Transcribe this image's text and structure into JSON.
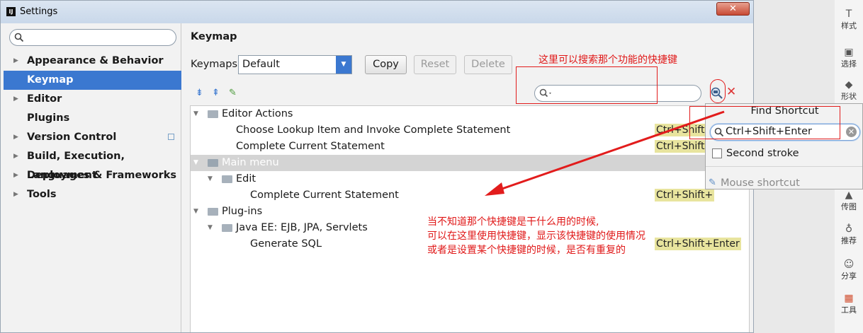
{
  "window": {
    "title": "Settings",
    "app_icon_text": "IJ",
    "close": "✕"
  },
  "sidebar": {
    "search_placeholder": "",
    "items": [
      {
        "label": "Appearance & Behavior",
        "arrow": "▶"
      },
      {
        "label": "Keymap",
        "arrow": ""
      },
      {
        "label": "Editor",
        "arrow": "▶"
      },
      {
        "label": "Plugins",
        "arrow": ""
      },
      {
        "label": "Version Control",
        "arrow": "▶"
      },
      {
        "label": "Build, Execution, Deployment",
        "arrow": "▶"
      },
      {
        "label": "Languages & Frameworks",
        "arrow": "▶"
      },
      {
        "label": "Tools",
        "arrow": "▶"
      }
    ]
  },
  "main": {
    "title": "Keymap",
    "keymaps_label": "Keymaps:",
    "keymap_value": "Default",
    "buttons": {
      "copy": "Copy",
      "reset": "Reset",
      "delete": "Delete"
    }
  },
  "tree": {
    "rows": [
      {
        "text": "Editor Actions",
        "toggle": "▼",
        "shortcut": ""
      },
      {
        "text": "Choose Lookup Item and Invoke Complete Statement",
        "toggle": "",
        "shortcut": "Ctrl+Shift+"
      },
      {
        "text": "Complete Current Statement",
        "toggle": "",
        "shortcut": "Ctrl+Shift+"
      },
      {
        "text": "Main menu",
        "toggle": "▼",
        "shortcut": ""
      },
      {
        "text": "Edit",
        "toggle": "▼",
        "shortcut": ""
      },
      {
        "text": "Complete Current Statement",
        "toggle": "",
        "shortcut": "Ctrl+Shift+"
      },
      {
        "text": "Plug-ins",
        "toggle": "▼",
        "shortcut": ""
      },
      {
        "text": "Java EE: EJB, JPA, Servlets",
        "toggle": "▼",
        "shortcut": ""
      },
      {
        "text": "Generate SQL",
        "toggle": "",
        "shortcut": "Ctrl+Shift+Enter"
      }
    ]
  },
  "find_popup": {
    "title": "Find Shortcut",
    "input_value": "Ctrl+Shift+Enter",
    "second_stroke": "Second stroke",
    "mouse_shortcut": "Mouse shortcut",
    "clear": "✕"
  },
  "toolbar_strip": [
    {
      "label": "样式",
      "icon": "style-icon"
    },
    {
      "label": "选择",
      "icon": "select-icon"
    },
    {
      "label": "形状",
      "icon": "shape-icon"
    },
    {
      "label": "传图",
      "icon": "upload-image-icon"
    },
    {
      "label": "推荐",
      "icon": "recommend-icon"
    },
    {
      "label": "分享",
      "icon": "share-icon"
    },
    {
      "label": "工具",
      "icon": "toolbox-icon"
    }
  ],
  "annotations": {
    "search_note": "这里可以搜索那个功能的快捷键",
    "line1": "当不知道那个快捷键是干什么用的时候,",
    "line2": "可以在这里使用快捷键，显示该快捷键的使用情况",
    "line3": "或者是设置某个快捷键的时候，是否有重复的"
  },
  "colors": {
    "selection": "#3b78d0",
    "annotation": "#e01818",
    "shortcut_highlight": "#e8e49e"
  }
}
